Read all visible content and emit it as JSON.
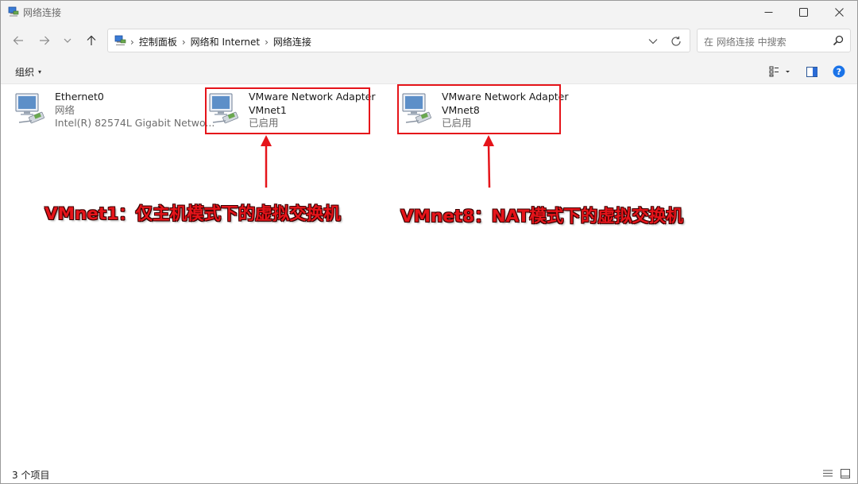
{
  "window": {
    "title": "网络连接"
  },
  "address": {
    "crumbs": [
      "控制面板",
      "网络和 Internet",
      "网络连接"
    ],
    "separator": "›"
  },
  "search": {
    "placeholder": "在 网络连接 中搜索"
  },
  "toolbar": {
    "organize_label": "组织",
    "organize_caret": "▾"
  },
  "items": [
    {
      "name": "Ethernet0",
      "status": "网络",
      "device": "Intel(R) 82574L Gigabit Netwo..."
    },
    {
      "name": "VMware Network Adapter",
      "status": "VMnet1",
      "device": "已启用"
    },
    {
      "name": "VMware Network Adapter",
      "status": "VMnet8",
      "device": "已启用"
    }
  ],
  "annotations": [
    "VMnet1：仅主机模式下的虚拟交换机",
    "VMnet8：NAT模式下的虚拟交换机"
  ],
  "status": {
    "item_count": "3 个项目"
  },
  "colors": {
    "highlight": "#e5141a",
    "chrome": "#f3f3f3",
    "help": "#1a73e8"
  },
  "icons": [
    "network-connections-icon",
    "minimize-icon",
    "maximize-icon",
    "close-icon",
    "back-icon",
    "forward-icon",
    "recent-icon",
    "up-icon",
    "refresh-icon",
    "search-icon",
    "view-options-icon",
    "preview-pane-icon",
    "help-icon",
    "network-adapter-icon",
    "details-view-icon",
    "large-icons-view-icon"
  ]
}
